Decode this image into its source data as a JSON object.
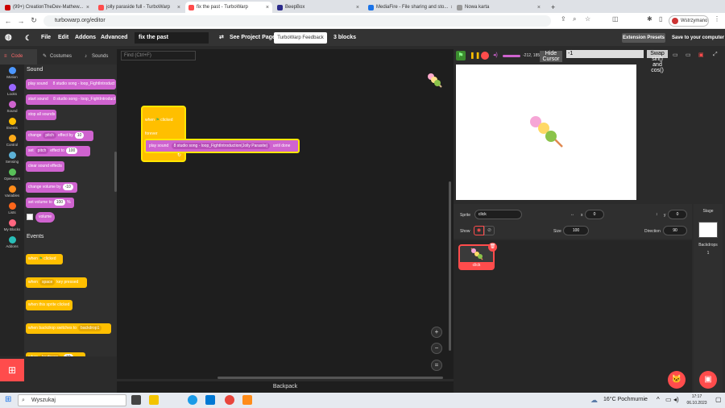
{
  "browser": {
    "tabs": [
      {
        "label": "(99+) CreationTheDev-Mathew...",
        "color": "#c00"
      },
      {
        "label": "jolly paraside full - TurboWarp",
        "color": "#ff4c4c"
      },
      {
        "label": "fix the past - TurboWarp",
        "color": "#ff4c4c"
      },
      {
        "label": "BeepBox",
        "color": "#2a2a8a"
      },
      {
        "label": "MediaFire - File sharing and sto...",
        "color": "#1a73e8"
      },
      {
        "label": "Nowa karta",
        "color": "#999"
      }
    ],
    "url": "turbowarp.org/editor",
    "profile": "Wstrzymano",
    "new_tab": "+"
  },
  "menu": {
    "items": [
      "File",
      "Edit",
      "Addons",
      "Advanced"
    ],
    "project_title": "fix the past",
    "see_project_page": "See Project Page",
    "feedback": "TurboWarp Feedback",
    "blocks_count": "3 blocks",
    "extension_presets": "Extension Presets",
    "save": "Save to your computer"
  },
  "editor_tabs": [
    "Code",
    "Costumes",
    "Sounds"
  ],
  "categories": [
    {
      "label": "Motion",
      "color": "#4c97ff"
    },
    {
      "label": "Looks",
      "color": "#9966ff"
    },
    {
      "label": "Sound",
      "color": "#cf63cf"
    },
    {
      "label": "Events",
      "color": "#ffbf00"
    },
    {
      "label": "Control",
      "color": "#ffab19"
    },
    {
      "label": "Sensing",
      "color": "#5cb1d6"
    },
    {
      "label": "Operators",
      "color": "#59c059"
    },
    {
      "label": "Variables",
      "color": "#ff8c1a"
    },
    {
      "label": "Lists",
      "color": "#ff661a"
    },
    {
      "label": "My Blocks",
      "color": "#ff6680"
    },
    {
      "label": "Addons",
      "color": "#29beb8"
    }
  ],
  "palette": {
    "sound_title": "Sound",
    "events_title": "Events",
    "b_play": "play sound",
    "b_play_arg": "8 studio song - loop_FightIntroduct",
    "b_start": "start sound",
    "b_stop": "stop all sounds",
    "b_change": "change",
    "b_pitch": "pitch",
    "b_effect_by": "effect by",
    "b_ten": "10",
    "b_set": "set",
    "b_effect_to": "effect to",
    "b_hundred": "100",
    "b_clear": "clear sound effects",
    "b_change_vol": "change volume by",
    "b_minus_ten": "-10",
    "b_set_vol": "set volume to",
    "b_pct": "%",
    "b_volume": "volume",
    "e_when": "when",
    "e_flag_clicked": "clicked",
    "e_space": "space",
    "e_key_pressed": "key pressed",
    "e_sprite_clicked": "when this sprite clicked",
    "e_backdrop": "when backdrop switches to",
    "e_backdrop_arg": "backdrop1",
    "e_loudness": "loudness"
  },
  "find_placeholder": "Find (Ctrl+F)",
  "script": {
    "when": "when",
    "clicked": "clicked",
    "forever": "forever",
    "play_until": "play sound",
    "sound_name": "8 studio song - loop_FightIntroduction(Jolly Parasite)",
    "until_done": "until done"
  },
  "backpack": "Backpack",
  "stage_bar": {
    "coords": "-212, 185",
    "hide_cursor": "Hide Cursor",
    "value_box": "-1",
    "swap": "Swap"
  },
  "stage_text": {
    "sin": "sin()",
    "and": "and",
    "cos": "cos()"
  },
  "sprite_info": {
    "sprite_label": "Sprite",
    "sprite_name": "click",
    "x_label": "x",
    "x_value": "0",
    "y_label": "y",
    "y_value": "0",
    "show_label": "Show",
    "size_label": "Size",
    "size_value": "100",
    "direction_label": "Direction",
    "direction_value": "90"
  },
  "sprite_thumb_label": "click",
  "stage_panel": {
    "title": "Stage",
    "backdrops": "Backdrops",
    "count": "1"
  },
  "taskbar": {
    "search": "Wyszukaj",
    "weather": "16°C  Pochmurnie",
    "time": "17:17",
    "date": "06.10.2023"
  }
}
